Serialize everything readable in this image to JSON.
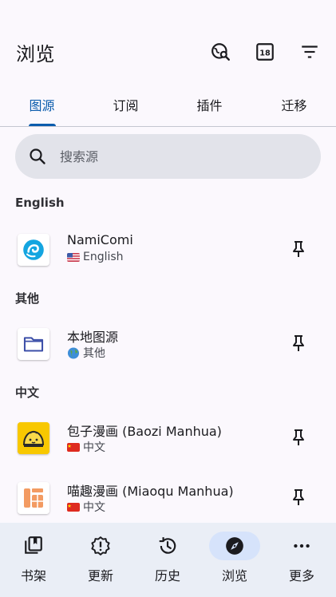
{
  "header": {
    "title": "浏览",
    "icons": [
      "global-search-icon",
      "nsfw-18-icon",
      "filter-icon"
    ]
  },
  "tabs": [
    {
      "label": "图源",
      "active": true
    },
    {
      "label": "订阅",
      "active": false
    },
    {
      "label": "插件",
      "active": false
    },
    {
      "label": "迁移",
      "active": false
    }
  ],
  "search": {
    "placeholder": "搜索源"
  },
  "sections": [
    {
      "title": "English",
      "items": [
        {
          "name": "NamiComi",
          "lang": "English",
          "flag": "us-flag"
        }
      ]
    },
    {
      "title": "其他",
      "items": [
        {
          "name": "本地图源",
          "lang": "其他",
          "flag": "globe"
        }
      ]
    },
    {
      "title": "中文",
      "items": [
        {
          "name": "包子漫画 (Baozi Manhua)",
          "lang": "中文",
          "flag": "cn-flag"
        },
        {
          "name": "喵趣漫画 (Miaoqu Manhua)",
          "lang": "中文",
          "flag": "cn-flag"
        }
      ]
    }
  ],
  "bottom_nav": [
    {
      "label": "书架",
      "icon": "library-icon",
      "active": false
    },
    {
      "label": "更新",
      "icon": "updates-icon",
      "active": false
    },
    {
      "label": "历史",
      "icon": "history-icon",
      "active": false
    },
    {
      "label": "浏览",
      "icon": "explore-icon",
      "active": true
    },
    {
      "label": "更多",
      "icon": "more-icon",
      "active": false
    }
  ],
  "colors": {
    "accent": "#0b5cad",
    "background": "#fbf8fd",
    "search_bg": "#e2e3ea",
    "nav_bg": "#eaeef6",
    "nav_active_pill": "#d6e3fb"
  }
}
